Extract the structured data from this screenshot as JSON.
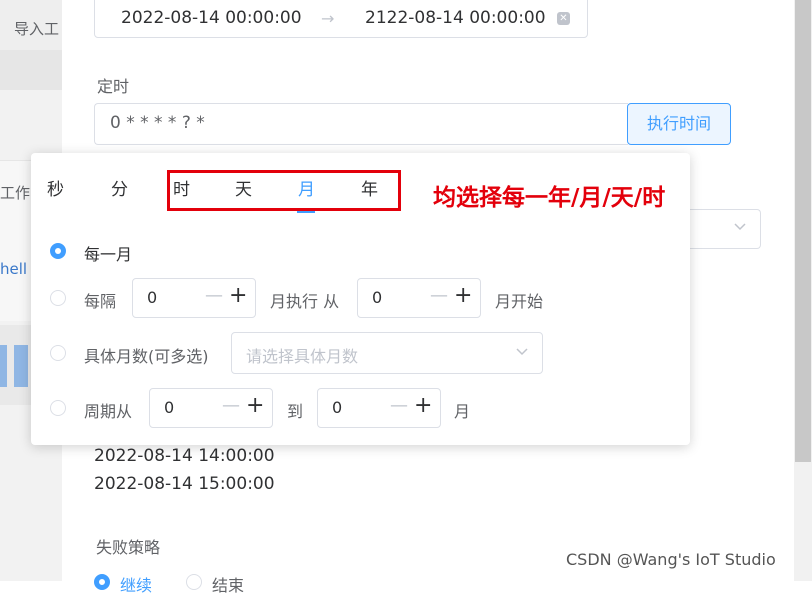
{
  "background_left": {
    "import_label": "导入工",
    "work_label": "工作",
    "link_label": "hell"
  },
  "range": {
    "start": "2022-08-14 00:00:00",
    "separator": "→",
    "end": "2122-08-14 00:00:00"
  },
  "schedule": {
    "label": "定时",
    "cron_value": "0 * * * * ? *",
    "exec_button": "执行时间"
  },
  "cron_popover": {
    "tabs": [
      {
        "label": "秒",
        "active": false
      },
      {
        "label": "分",
        "active": false
      },
      {
        "label": "时",
        "active": false
      },
      {
        "label": "天",
        "active": false
      },
      {
        "label": "月",
        "active": true
      },
      {
        "label": "年",
        "active": false
      }
    ],
    "annotation": "均选择每一年/月/天/时",
    "options": {
      "every": {
        "label": "每一月",
        "checked": true
      },
      "interval": {
        "prefix": "每隔",
        "value1": "0",
        "middle": "月执行 从",
        "value2": "0",
        "suffix": "月开始",
        "checked": false
      },
      "specific": {
        "label": "具体月数(可多选)",
        "placeholder": "请选择具体月数",
        "checked": false
      },
      "cycle": {
        "prefix": "周期从",
        "value1": "0",
        "middle": "到",
        "value2": "0",
        "suffix": "月",
        "checked": false
      }
    }
  },
  "execution_times": [
    "2022-08-14 14:00:00",
    "2022-08-14 15:00:00"
  ],
  "failure_strategy": {
    "label": "失败策略",
    "options": [
      "继续",
      "结束"
    ],
    "selected": "继续"
  },
  "watermark": "CSDN @Wang's IoT Studio",
  "colors": {
    "primary": "#409eff",
    "annotation_red": "#e3000b",
    "border": "#dcdfe6"
  }
}
